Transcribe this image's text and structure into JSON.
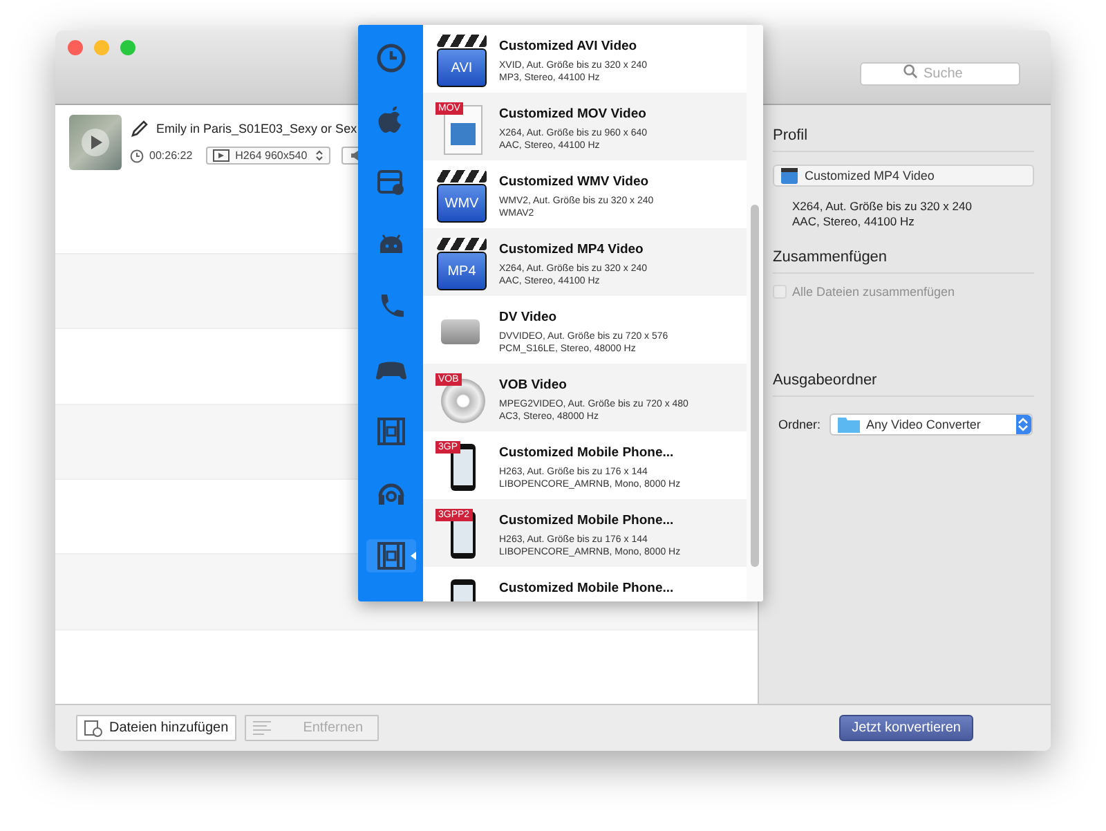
{
  "search": {
    "placeholder": "Suche"
  },
  "file": {
    "name": "Emily in Paris_S01E03_Sexy or Sex",
    "duration": "00:26:22",
    "format": "H264 960x540"
  },
  "categories": [
    {
      "kind": "clock",
      "selected": false
    },
    {
      "kind": "apple",
      "selected": false
    },
    {
      "kind": "drive",
      "selected": false
    },
    {
      "kind": "android",
      "selected": false
    },
    {
      "kind": "phone",
      "selected": false
    },
    {
      "kind": "gamepad",
      "selected": false
    },
    {
      "kind": "film",
      "selected": false
    },
    {
      "kind": "headset",
      "selected": false
    },
    {
      "kind": "filmbox",
      "selected": true
    }
  ],
  "profiles": [
    {
      "kind": "clapper",
      "badge": "AVI",
      "title": "Customized AVI Video",
      "line1": "XVID, Aut. Größe bis zu 320 x 240",
      "line2": "MP3, Stereo, 44100 Hz"
    },
    {
      "kind": "document",
      "badge": "MOV",
      "title": "Customized MOV Video",
      "line1": "X264, Aut. Größe bis zu 960 x 640",
      "line2": "AAC, Stereo, 44100 Hz"
    },
    {
      "kind": "clapper",
      "badge": "WMV",
      "title": "Customized WMV Video",
      "line1": "WMV2, Aut. Größe bis zu 320 x 240",
      "line2": "WMAV2"
    },
    {
      "kind": "clapper",
      "badge": "MP4",
      "title": "Customized MP4 Video",
      "line1": "X264, Aut. Größe bis zu 320 x 240",
      "line2": "AAC, Stereo, 44100 Hz"
    },
    {
      "kind": "camera",
      "title": "DV Video",
      "line1": "DVVIDEO, Aut. Größe bis zu 720 x 576",
      "line2": "PCM_S16LE, Stereo, 48000 Hz"
    },
    {
      "kind": "disc",
      "badge": "VOB",
      "title": "VOB Video",
      "line1": "MPEG2VIDEO, Aut. Größe bis zu 720 x 480",
      "line2": "AC3, Stereo, 48000 Hz"
    },
    {
      "kind": "phone",
      "badge": "3GP",
      "title": "Customized Mobile Phone...",
      "line1": "H263, Aut. Größe bis zu 176 x 144",
      "line2": "LIBOPENCORE_AMRNB, Mono, 8000 Hz"
    },
    {
      "kind": "phone",
      "badge": "3GPP2",
      "title": "Customized Mobile Phone...",
      "line1": "H263, Aut. Größe bis zu 176 x 144",
      "line2": "LIBOPENCORE_AMRNB, Mono, 8000 Hz"
    },
    {
      "kind": "phone",
      "title": "Customized Mobile Phone..."
    }
  ],
  "profile_panel": {
    "heading": "Profil",
    "selected": "Customized MP4 Video",
    "line1": "X264, Aut. Größe bis zu 320 x 240",
    "line2": "AAC, Stereo, 44100 Hz"
  },
  "merge": {
    "heading": "Zusammenfügen",
    "label": "Alle Dateien zusammenfügen",
    "checked": false,
    "disabled": true
  },
  "output": {
    "heading": "Ausgabeordner",
    "label": "Ordner:",
    "folder": "Any Video Converter"
  },
  "buttons": {
    "add": "Dateien hinzufügen",
    "remove": "Entfernen",
    "remove_disabled": true,
    "convert": "Jetzt konvertieren"
  }
}
